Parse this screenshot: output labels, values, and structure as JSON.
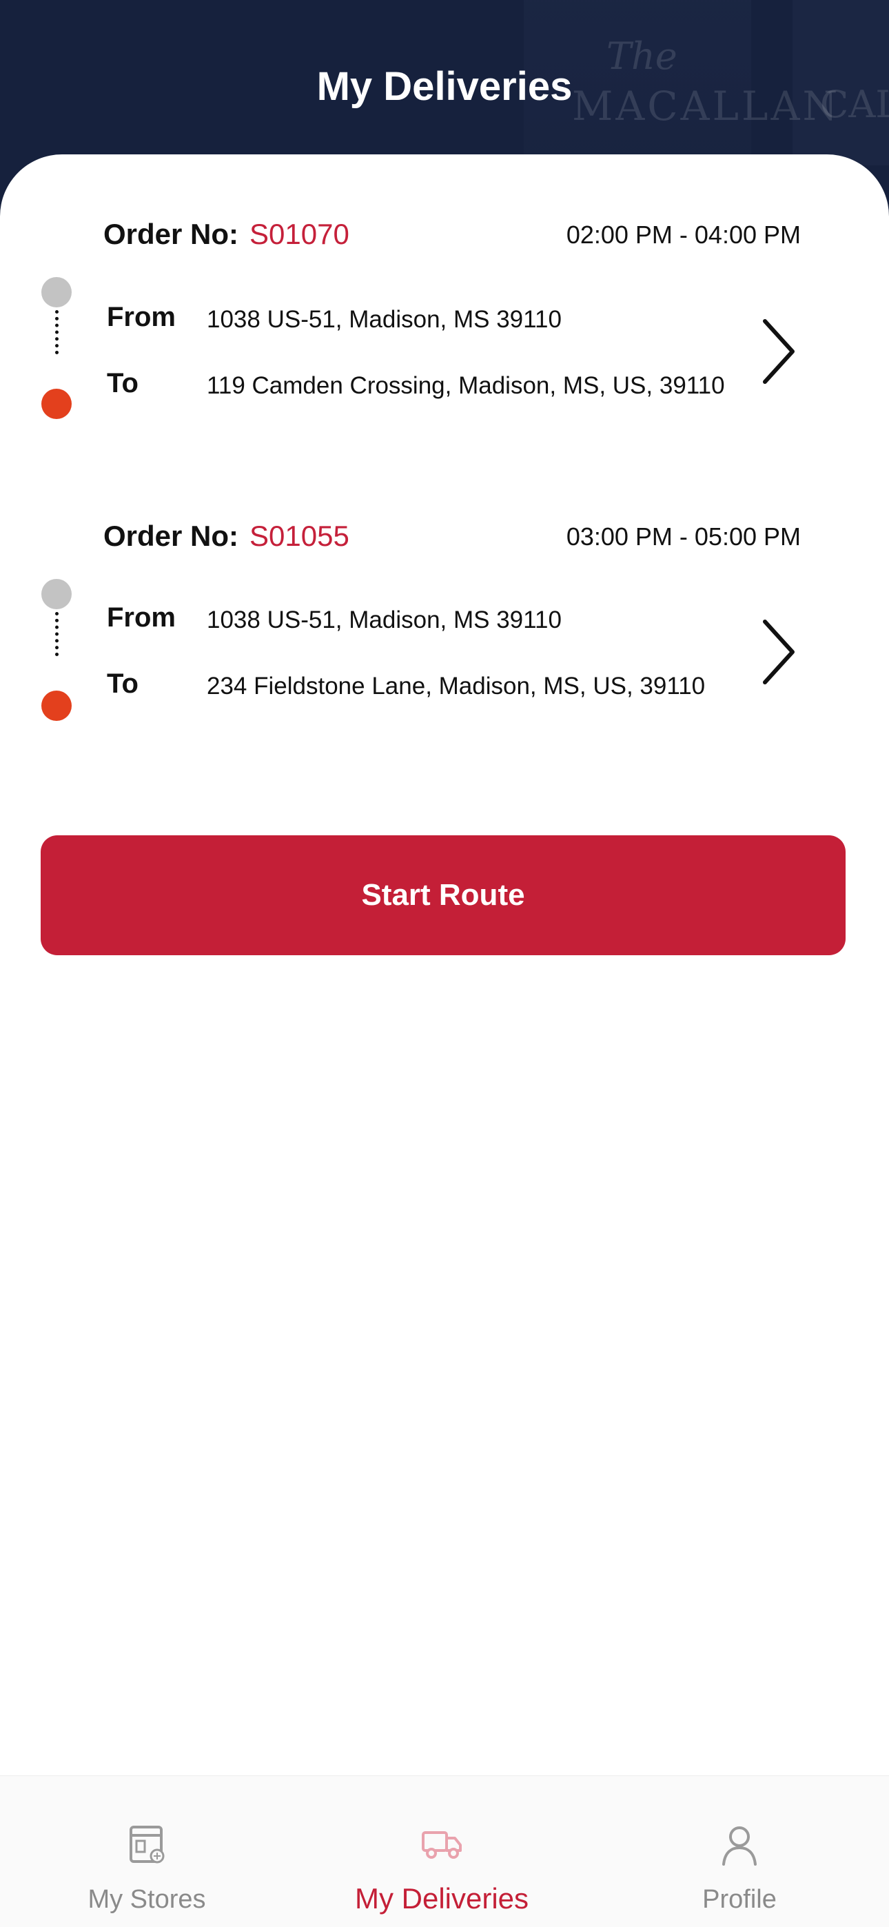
{
  "header": {
    "title": "My Deliveries"
  },
  "deliveries": [
    {
      "order_label": "Order No:",
      "order_id": "S01070",
      "time_slot": "02:00 PM - 04:00 PM",
      "from_label": "From",
      "from_address": "1038 US-51, Madison, MS 39110",
      "to_label": "To",
      "to_address": "119 Camden Crossing, Madison, MS, US, 39110"
    },
    {
      "order_label": "Order No:",
      "order_id": "S01055",
      "time_slot": "03:00 PM - 05:00 PM",
      "from_label": "From",
      "from_address": "1038 US-51, Madison, MS 39110",
      "to_label": "To",
      "to_address": "234 Fieldstone Lane, Madison, MS, US, 39110"
    }
  ],
  "actions": {
    "start_route_label": "Start Route"
  },
  "bottom_nav": {
    "items": [
      {
        "label": "My Stores",
        "icon": "store-icon",
        "active": false
      },
      {
        "label": "My Deliveries",
        "icon": "delivery-truck-icon",
        "active": true
      },
      {
        "label": "Profile",
        "icon": "profile-icon",
        "active": false
      }
    ]
  },
  "colors": {
    "header_bg": "#16213d",
    "accent": "#c41f37",
    "route_start_dot": "#c3c3c3",
    "route_end_dot": "#e3401d",
    "nav_inactive": "#8a8a8a"
  }
}
